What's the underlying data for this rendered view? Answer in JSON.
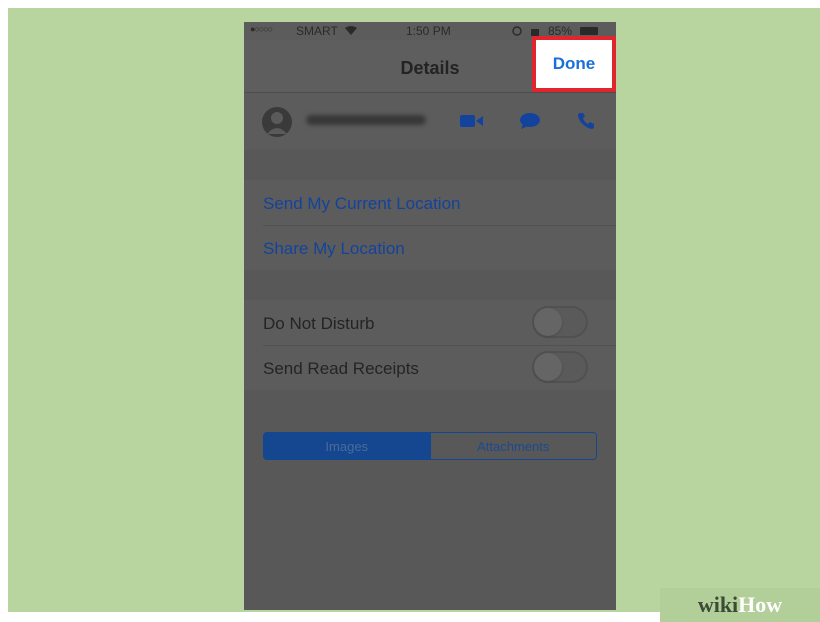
{
  "status_bar": {
    "signal": "●○○○○",
    "carrier": "SMART",
    "wifi_icon": "wifi-icon",
    "time": "1:50 PM",
    "battery": "85%"
  },
  "navbar": {
    "title": "Details",
    "done_label": "Done",
    "highlight_color": "#e0262c"
  },
  "contact": {
    "avatar_icon": "person-icon",
    "actions": [
      "video-call-icon",
      "message-icon",
      "phone-icon"
    ]
  },
  "location": {
    "send_current": "Send My Current Location",
    "share": "Share My Location"
  },
  "settings": {
    "do_not_disturb": "Do Not Disturb",
    "do_not_disturb_on": false,
    "read_receipts": "Send Read Receipts",
    "read_receipts_on": false
  },
  "segments": {
    "options": [
      "Images",
      "Attachments"
    ],
    "selected": "Images"
  },
  "watermark": {
    "wiki": "wiki",
    "how": "How"
  },
  "colors": {
    "background": "#b8d5a0",
    "link": "#13439c",
    "done": "#1a6fd8"
  }
}
